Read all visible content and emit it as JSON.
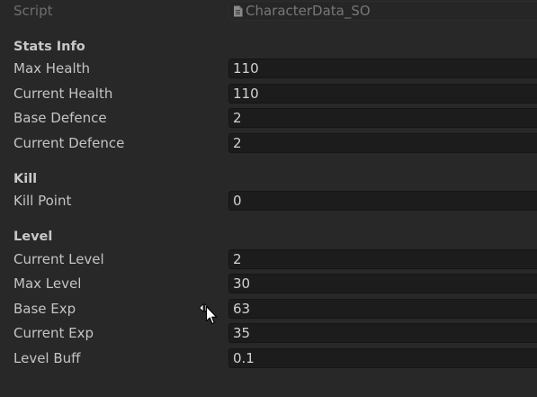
{
  "script": {
    "label": "Script",
    "value": "CharacterData_SO",
    "icon": "script-file-icon"
  },
  "sections": [
    {
      "header": "Stats Info",
      "fields": [
        {
          "label": "Max Health",
          "value": "110"
        },
        {
          "label": "Current Health",
          "value": "110"
        },
        {
          "label": "Base Defence",
          "value": "2"
        },
        {
          "label": "Current Defence",
          "value": "2"
        }
      ]
    },
    {
      "header": "Kill",
      "fields": [
        {
          "label": "Kill Point",
          "value": "0"
        }
      ]
    },
    {
      "header": "Level",
      "fields": [
        {
          "label": "Current Level",
          "value": "2"
        },
        {
          "label": "Max Level",
          "value": "30"
        },
        {
          "label": "Base Exp",
          "value": "63"
        },
        {
          "label": "Current Exp",
          "value": "35"
        },
        {
          "label": "Level Buff",
          "value": "0.1"
        }
      ]
    }
  ],
  "cursor": {
    "icon": "horizontal-drag-cursor-icon"
  }
}
